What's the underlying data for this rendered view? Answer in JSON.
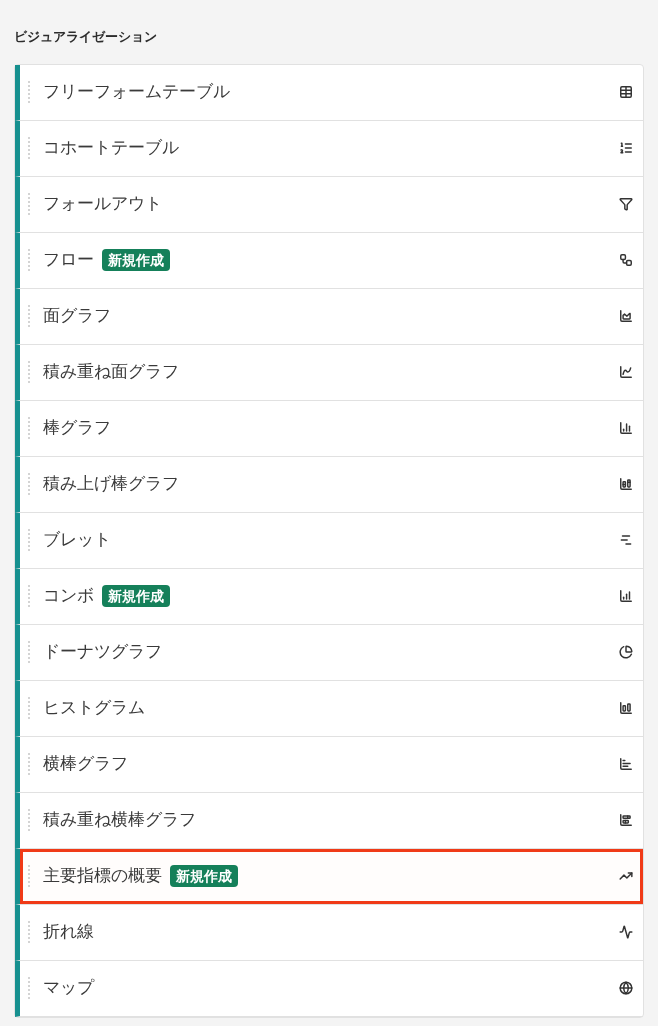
{
  "section_title": "ビジュアライゼーション",
  "items": [
    {
      "label": "フリーフォームテーブル",
      "highlighted": false
    },
    {
      "label": "コホートテーブル",
      "highlighted": false
    },
    {
      "label": "フォールアウト",
      "highlighted": false
    },
    {
      "label": "フロー",
      "badge": "新規作成",
      "highlighted": false
    },
    {
      "label": "面グラフ",
      "highlighted": false
    },
    {
      "label": "積み重ね面グラフ",
      "highlighted": false
    },
    {
      "label": "棒グラフ",
      "highlighted": false
    },
    {
      "label": "積み上げ棒グラフ",
      "highlighted": false
    },
    {
      "label": "ブレット",
      "highlighted": false
    },
    {
      "label": "コンボ",
      "badge": "新規作成",
      "highlighted": false
    },
    {
      "label": "ドーナツグラフ",
      "highlighted": false
    },
    {
      "label": "ヒストグラム",
      "highlighted": false
    },
    {
      "label": "横棒グラフ",
      "highlighted": false
    },
    {
      "label": "積み重ね横棒グラフ",
      "highlighted": false
    },
    {
      "label": "主要指標の概要",
      "badge": "新規作成",
      "highlighted": true
    },
    {
      "label": "折れ線",
      "highlighted": false
    },
    {
      "label": "マップ",
      "highlighted": false
    }
  ]
}
